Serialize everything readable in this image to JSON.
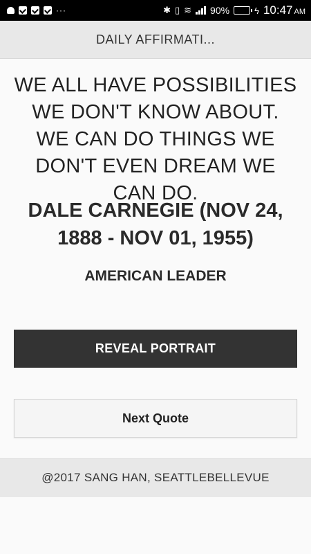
{
  "status_bar": {
    "battery_text": "90%",
    "battery_level": 0.9,
    "time": "10:47",
    "ampm": "AM",
    "more": "···",
    "icons": [
      "android-icon",
      "check-task-icon",
      "briefcase-check-icon",
      "check-task-icon",
      "bluetooth-icon",
      "vibrate-icon",
      "wifi-icon",
      "signal-icon",
      "battery-icon",
      "charging-icon"
    ],
    "colors": {
      "battery_fill": "#4cd964"
    }
  },
  "app_bar": {
    "title": "DAILY AFFIRMATI..."
  },
  "quote": {
    "text": "WE ALL HAVE POSSIBILITIES WE DON'T KNOW ABOUT. WE CAN DO THINGS WE DON'T EVEN DREAM WE CAN DO.",
    "author": "DALE CARNEGIE (NOV 24, 1888 - NOV 01, 1955)",
    "occupation": "AMERICAN LEADER"
  },
  "buttons": {
    "reveal_label": "REVEAL PORTRAIT",
    "next_label": "Next Quote"
  },
  "footer": {
    "text": "@2017 SANG HAN, SEATTLEBELLEVUE"
  },
  "colors": {
    "reveal_bg": "#333333",
    "bar_bg": "#e8e8e8",
    "page_bg": "#fafafa"
  }
}
